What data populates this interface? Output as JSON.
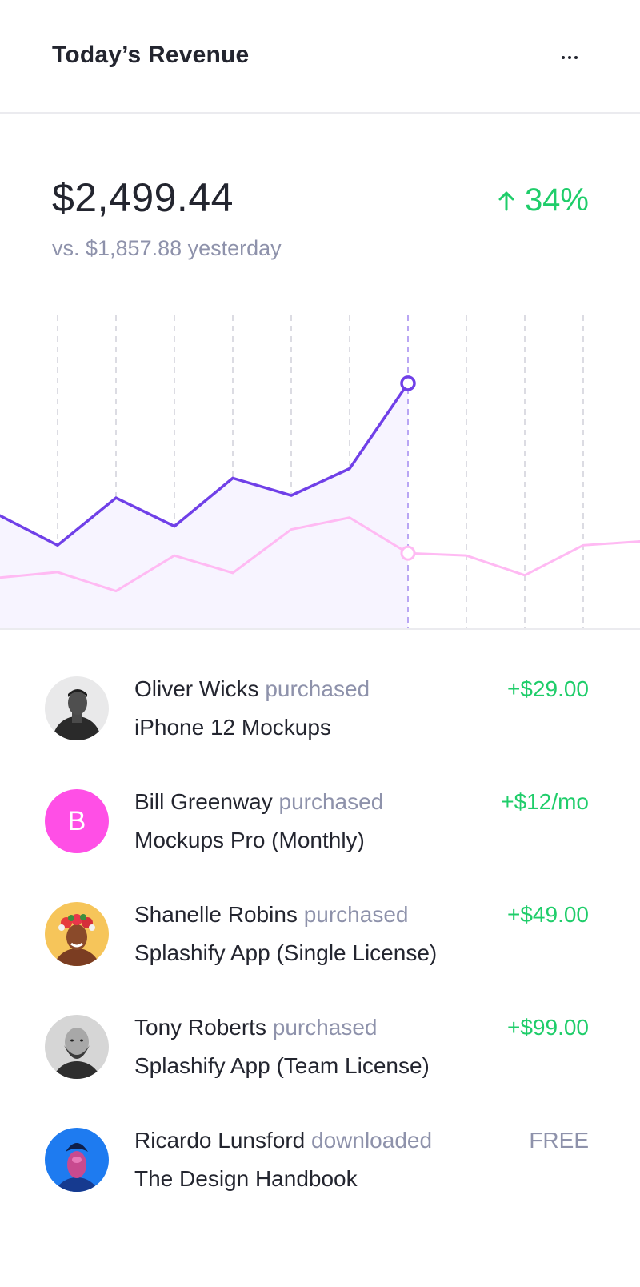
{
  "header": {
    "title": "Today’s Revenue",
    "menu_icon": "more-horizontal-icon"
  },
  "summary": {
    "amount": "$2,499.44",
    "comparison": "vs. $1,857.88 yesterday",
    "change": "34%",
    "change_icon": "arrow-up-icon",
    "change_color": "#1fcd6a"
  },
  "chart_data": {
    "type": "line",
    "title": "",
    "xlabel": "",
    "ylabel": "",
    "grid": "vertical dashed",
    "highlight_index": 7,
    "series": [
      {
        "role": "today",
        "color": "#7040e8",
        "fill": "#f7f4ff",
        "values": [
          14.3,
          10.5,
          16.5,
          12.9,
          19.0,
          16.8,
          20.2,
          31.0
        ]
      },
      {
        "role": "yesterday",
        "color": "#ffbaf3",
        "values": [
          6.4,
          7.1,
          4.7,
          9.2,
          7.0,
          12.5,
          14.0,
          9.5,
          9.2,
          6.7,
          10.5,
          11.0
        ]
      }
    ],
    "ylim": [
      0,
      40
    ]
  },
  "activity": [
    {
      "name": "Oliver Wicks",
      "verb": "purchased",
      "product": "iPhone 12 Mockups",
      "amount": "+$29.00",
      "avatar": "photo-man-dark",
      "free": false
    },
    {
      "name": "Bill Greenway",
      "verb": "purchased",
      "product": "Mockups Pro (Monthly)",
      "amount": "+$12/mo",
      "avatar": "letter",
      "initial": "B",
      "avatar_color": "#ff4fe6",
      "free": false
    },
    {
      "name": "Shanelle Robins",
      "verb": "purchased",
      "product": "Splashify App (Single License)",
      "amount": "+$49.00",
      "avatar": "photo-woman-flowers",
      "free": false
    },
    {
      "name": "Tony Roberts",
      "verb": "purchased",
      "product": "Splashify App (Team License)",
      "amount": "+$99.00",
      "avatar": "photo-bearded-man",
      "free": false
    },
    {
      "name": "Ricardo Lunsford",
      "verb": "downloaded",
      "product": "The Design Handbook",
      "amount": "FREE",
      "avatar": "photo-man-blue",
      "free": true
    }
  ]
}
